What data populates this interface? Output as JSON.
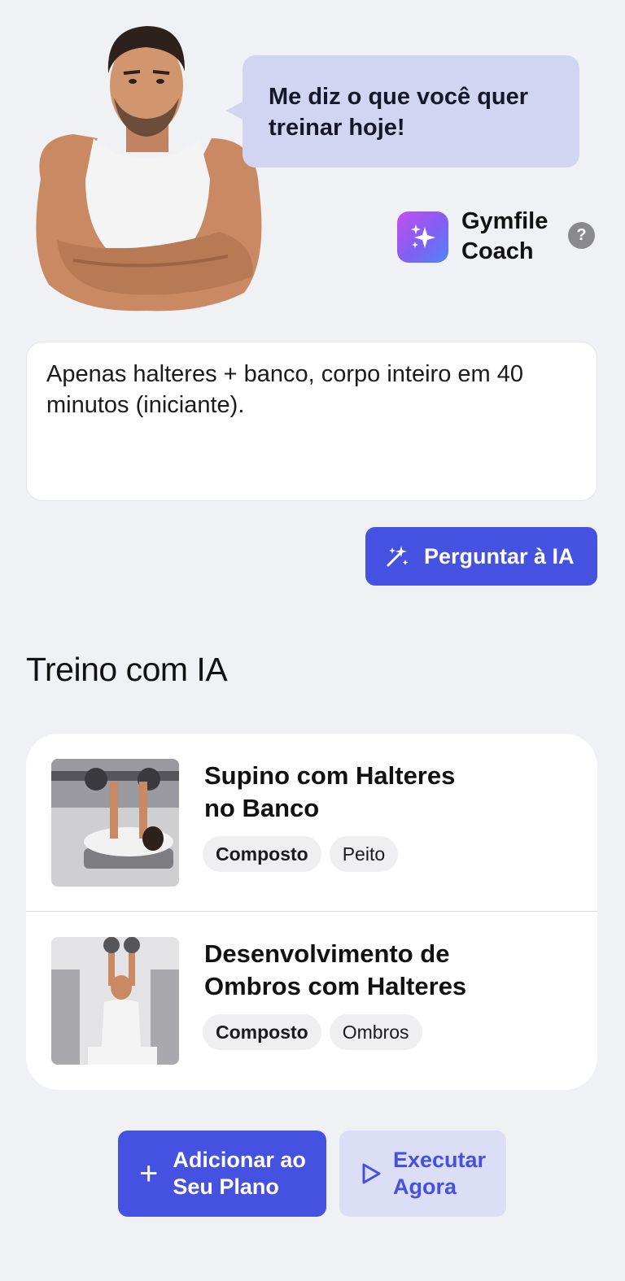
{
  "coach": {
    "speech_bubble": "Me diz o que você quer treinar hoje!",
    "name_line1": "Gymfile",
    "name_line2": "Coach",
    "help_label": "?"
  },
  "prompt": {
    "value": "Apenas halteres + banco, corpo inteiro em 40 minutos (iniciante)."
  },
  "ask_button": {
    "label": "Perguntar à IA",
    "icon": "magic-wand-icon"
  },
  "section": {
    "title": "Treino com IA"
  },
  "exercises": [
    {
      "title_line1": "Supino com Halteres",
      "title_line2": "no Banco",
      "tags": [
        "Composto",
        "Peito"
      ]
    },
    {
      "title_line1": "Desenvolvimento de",
      "title_line2": "Ombros com Halteres",
      "tags": [
        "Composto",
        "Ombros"
      ]
    }
  ],
  "actions": {
    "add_line1": "Adicionar ao",
    "add_line2": "Seu Plano",
    "run_line1": "Executar",
    "run_line2": "Agora"
  },
  "colors": {
    "accent": "#4551e0",
    "bubble": "#d2d5f2",
    "background": "#f0f1f5",
    "secondary_button": "#dcdef5"
  }
}
